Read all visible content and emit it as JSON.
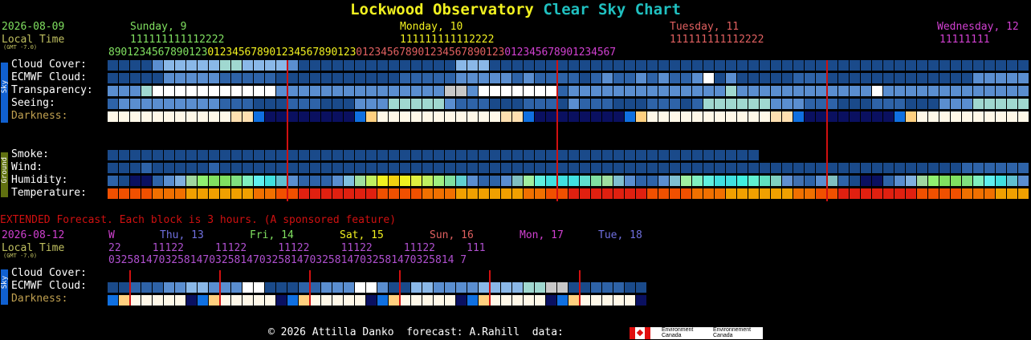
{
  "title": {
    "part1": "Lockwood Observatory",
    "part2": "Clear Sky Chart"
  },
  "colors": {
    "yellow": "#f0f020",
    "cyan": "#20c0c0",
    "green": "#80e060",
    "olive": "#c0c060",
    "magenta": "#d040d0",
    "orange": "#e06060",
    "blue": "#7070e0",
    "red_line": "#d01010"
  },
  "header": {
    "date": "2026-08-09",
    "local_time": "Local Time",
    "gmt": "(GMT -7.0)",
    "days": [
      {
        "label": "Sunday, 9",
        "color": "#80e060"
      },
      {
        "label": "Monday, 10",
        "color": "#f0f020"
      },
      {
        "label": "Tuesday, 11",
        "color": "#e06060"
      },
      {
        "label": "Wednesday, 12",
        "color": "#d040d0"
      }
    ],
    "hours_tens": "111111111112222",
    "hours_ones": "8901234567890123012345678901234567890123012345678901234567890123012345678901234567"
  },
  "sky_tab": "Sky",
  "ground_tab": "Ground",
  "rows": {
    "cloud_cover": "Cloud Cover:",
    "ecmwf_cloud": "ECMWF Cloud:",
    "transparency": "Transparency:",
    "seeing": "Seeing:",
    "darkness": "Darkness:",
    "smoke": "Smoke:",
    "wind": "Wind:",
    "humidity": "Humidity:",
    "temperature": "Temperature:"
  },
  "extended": {
    "notice": "EXTENDED Forecast. Each block is 3 hours. (A sponsored feature)",
    "date": "2026-08-12",
    "local_time": "Local Time",
    "gmt": "(GMT -7.0)",
    "days": [
      {
        "label": "W",
        "color": "#d040d0"
      },
      {
        "label": "Thu, 13",
        "color": "#7070e0"
      },
      {
        "label": "Fri, 14",
        "color": "#80e060"
      },
      {
        "label": "Sat, 15",
        "color": "#f0f020"
      },
      {
        "label": "Sun, 16",
        "color": "#e06060"
      },
      {
        "label": "Mon, 17",
        "color": "#d040d0"
      },
      {
        "label": "Tue, 18",
        "color": "#7070e0"
      }
    ],
    "tens_line": "22     11122     11122     11122     11122     11122     111",
    "ones_line": "0325814703258147032581470325814703258147032581470325814 7",
    "cloud_cover": "Cloud Cover:",
    "ecmwf_cloud": "ECMWF Cloud:",
    "darkness": "Darkness:"
  },
  "footer": {
    "text": "© 2026 Attilla Danko  forecast: A.Rahill  data:",
    "agency_en": "Environment Canada",
    "agency_fr": "Environnement Canada"
  }
}
